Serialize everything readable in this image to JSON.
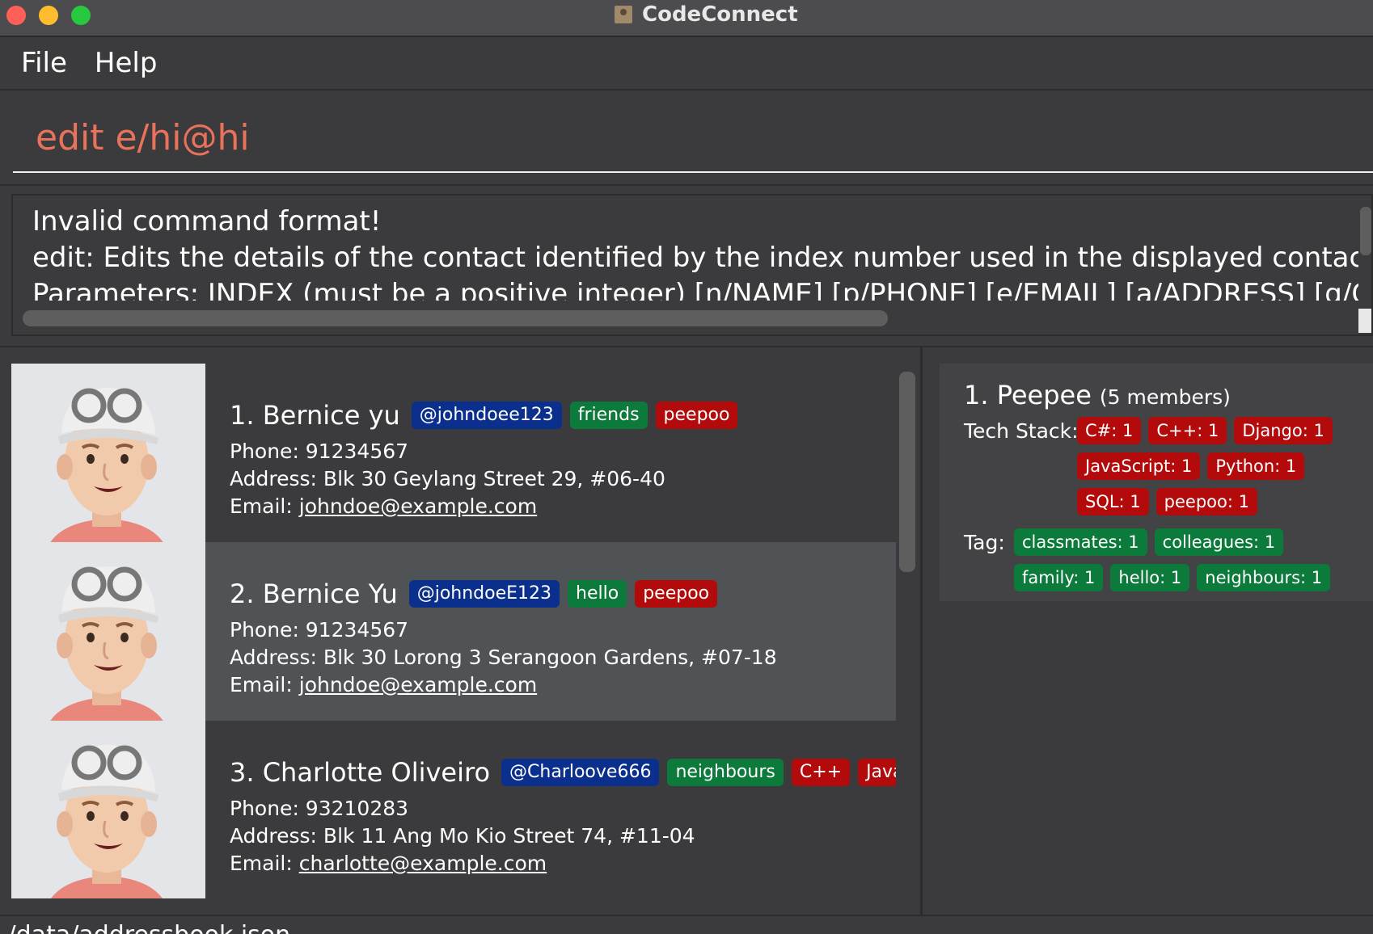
{
  "window": {
    "title": "CodeConnect"
  },
  "menu": {
    "file": "File",
    "help": "Help"
  },
  "command": {
    "value": "edit e/hi@hi"
  },
  "result": {
    "text": "Invalid command format!\nedit: Edits the details of the contact identified by the index number used in the displayed contact list. Existin\nParameters: INDEX (must be a positive integer) [n/NAME] [p/PHONE] [e/EMAIL] [a/ADDRESS] [g/GITHUB"
  },
  "contacts": [
    {
      "index": "1.",
      "name": "Bernice yu",
      "github": "@johndoee123",
      "tags": [
        {
          "text": "friends",
          "color": "green"
        },
        {
          "text": "peepoo",
          "color": "red"
        }
      ],
      "phone": "Phone: 91234567",
      "address": "Address: Blk 30 Geylang Street 29, #06-40",
      "email_label": "Email:",
      "email": "johndoe@example.com"
    },
    {
      "index": "2.",
      "name": "Bernice Yu",
      "github": "@johndoeE123",
      "tags": [
        {
          "text": "hello",
          "color": "green"
        },
        {
          "text": "peepoo",
          "color": "red"
        }
      ],
      "phone": "Phone: 91234567",
      "address": "Address: Blk 30 Lorong 3 Serangoon Gardens, #07-18",
      "email_label": "Email:",
      "email": "johndoe@example.com"
    },
    {
      "index": "3.",
      "name": "Charlotte Oliveiro",
      "github": "@Charloove666",
      "tags": [
        {
          "text": "neighbours",
          "color": "green"
        },
        {
          "text": "C++",
          "color": "red"
        },
        {
          "text": "JavaScript",
          "color": "red"
        }
      ],
      "phone": "Phone: 93210283",
      "address": "Address: Blk 11 Ang Mo Kio Street 74, #11-04",
      "email_label": "Email:",
      "email": "charlotte@example.com"
    }
  ],
  "group": {
    "index": "1.",
    "name": "Peepee",
    "members": "(5 members)",
    "tech_label": "Tech Stack:",
    "tech": [
      "C#: 1",
      "C++: 1",
      "Django: 1",
      "JavaScript: 1",
      "Python: 1",
      "SQL: 1",
      "peepoo: 1"
    ],
    "tag_label": "Tag:",
    "tags": [
      "classmates: 1",
      "colleagues: 1",
      "family: 1",
      "hello: 1",
      "neighbours: 1"
    ]
  },
  "status": {
    "path": "./data/addressbook.json"
  },
  "colors": {
    "github_badge": "#0b2f8c",
    "green_badge": "#0b7a3a",
    "red_badge": "#b30b0b",
    "command_text": "#e8735a"
  }
}
